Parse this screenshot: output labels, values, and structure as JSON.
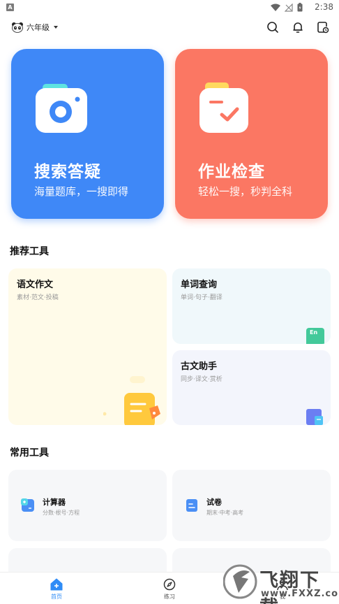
{
  "status_bar": {
    "app_badge": "A",
    "time": "2:38"
  },
  "header": {
    "grade": "六年级"
  },
  "hero": [
    {
      "title": "搜索答疑",
      "subtitle": "海量题库，一搜即得",
      "color": "#3f88f7"
    },
    {
      "title": "作业检查",
      "subtitle": "轻松一搜，秒判全科",
      "color": "#fb7763"
    }
  ],
  "recommended": {
    "title": "推荐工具",
    "items": [
      {
        "title": "语文作文",
        "subtitle": "素材·范文·投稿"
      },
      {
        "title": "单词查询",
        "subtitle": "单词·句子·翻译",
        "badge": "En"
      },
      {
        "title": "古文助手",
        "subtitle": "同步·译文·赏析"
      }
    ]
  },
  "common": {
    "title": "常用工具",
    "items": [
      {
        "title": "计算器",
        "subtitle": "分数·根号·方程"
      },
      {
        "title": "试卷",
        "subtitle": "期末·中考·高考"
      }
    ]
  },
  "nav": {
    "items": [
      {
        "label": "首页",
        "icon": "home-icon"
      },
      {
        "label": "练习",
        "icon": "compass-icon"
      },
      {
        "label": "我",
        "icon": "profile-icon"
      }
    ]
  },
  "watermark": {
    "text": "飞翔下载",
    "url": "www.FXXZ.com"
  },
  "colors": {
    "accent": "#2f8cf6",
    "hero_blue": "#3f88f7",
    "hero_red": "#fb7763"
  }
}
